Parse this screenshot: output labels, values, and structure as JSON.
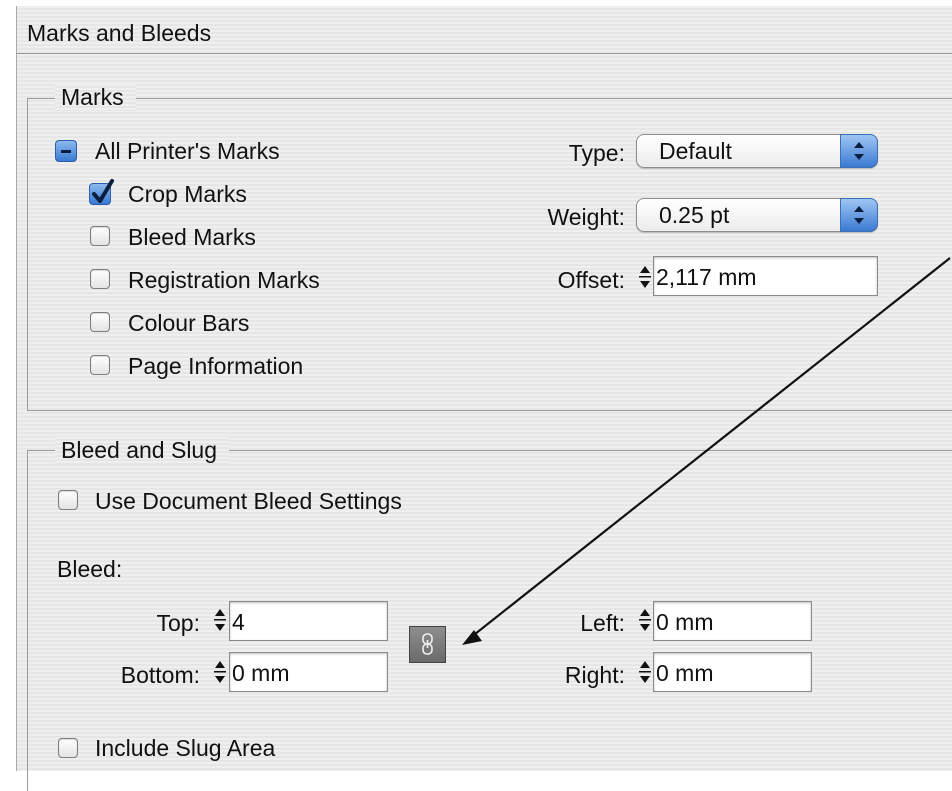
{
  "title": "Marks and Bleeds",
  "marks": {
    "legend": "Marks",
    "all_printers_marks": "All Printer's Marks",
    "crop_marks": "Crop Marks",
    "bleed_marks": "Bleed Marks",
    "registration_marks": "Registration Marks",
    "colour_bars": "Colour Bars",
    "page_information": "Page Information",
    "type_label": "Type:",
    "type_value": "Default",
    "weight_label": "Weight:",
    "weight_value": "0.25 pt",
    "offset_label": "Offset:",
    "offset_value": "2,117 mm"
  },
  "bleed_slug": {
    "legend": "Bleed and Slug",
    "use_document_bleed": "Use Document Bleed Settings",
    "bleed_label": "Bleed:",
    "top_label": "Top:",
    "top_value": "4",
    "bottom_label": "Bottom:",
    "bottom_value": "0 mm",
    "left_label": "Left:",
    "left_value": "0 mm",
    "right_label": "Right:",
    "right_value": "0 mm",
    "include_slug": "Include Slug Area"
  },
  "icons": {
    "link": "chain-link-icon",
    "stepper": "up-down-stepper-icon",
    "popup": "popup-arrows-icon"
  },
  "colors": {
    "accent_blue": "#3a7ad3",
    "panel_bg": "#ededed"
  }
}
